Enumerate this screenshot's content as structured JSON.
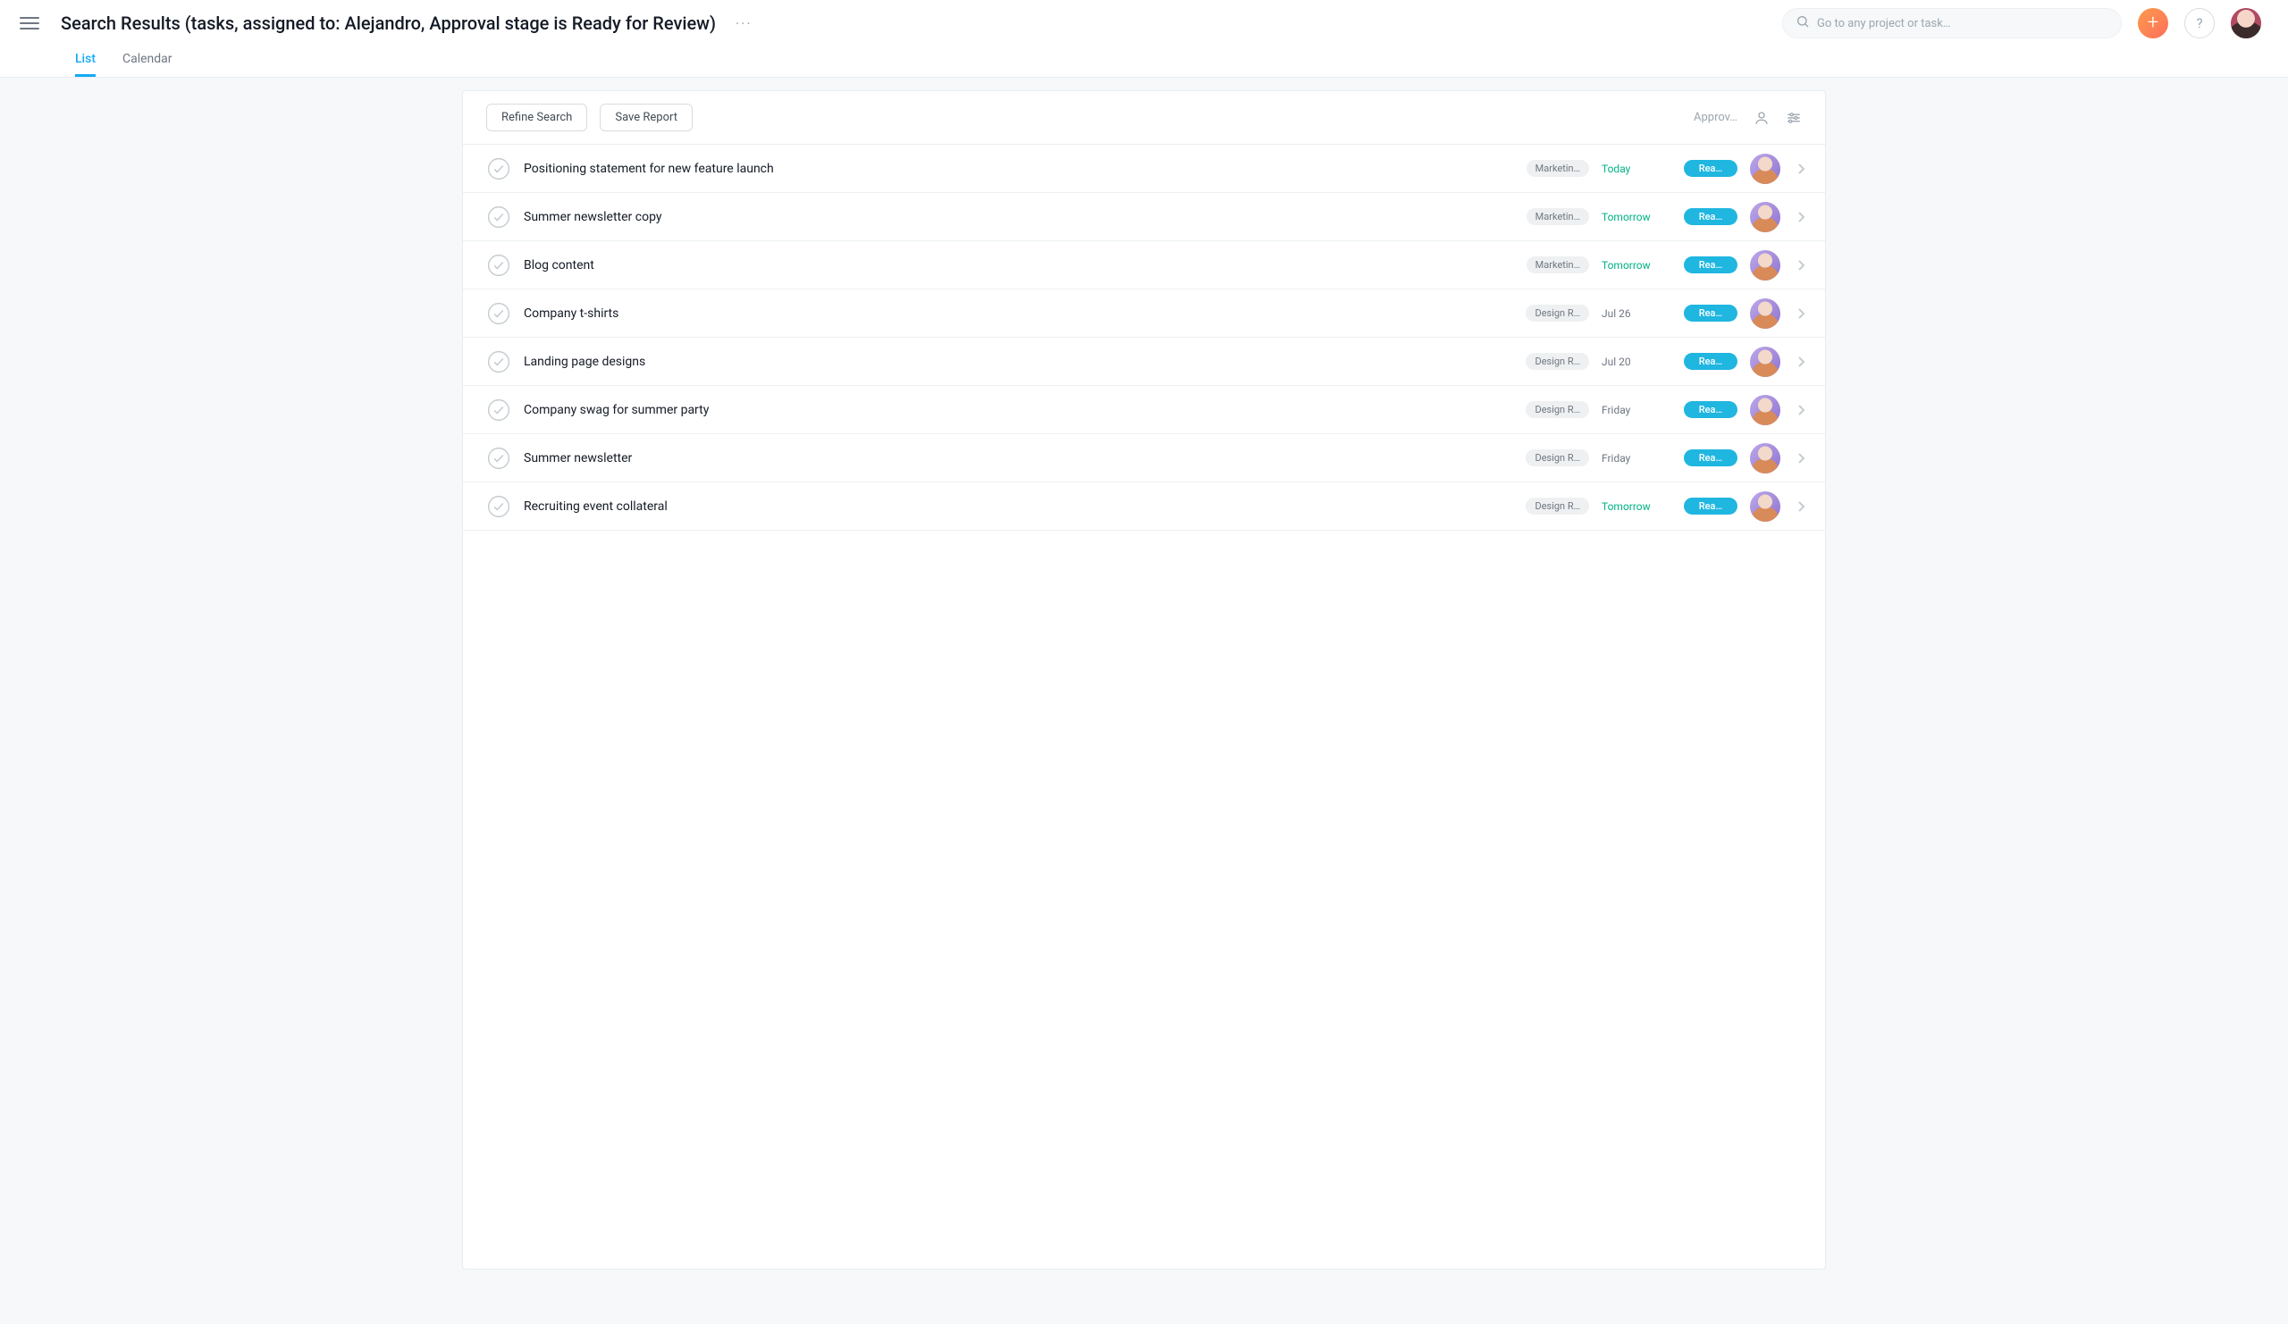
{
  "header": {
    "title": "Search Results (tasks, assigned to: Alejandro, Approval stage is Ready for Review)",
    "more_label": "···"
  },
  "search": {
    "placeholder": "Go to any project or task…"
  },
  "topbar_buttons": {
    "add_label": "+",
    "help_label": "?"
  },
  "tabs": [
    {
      "label": "List",
      "active": true
    },
    {
      "label": "Calendar",
      "active": false
    }
  ],
  "toolbar": {
    "refine_label": "Refine Search",
    "save_label": "Save Report",
    "filter_field_label": "Approv…"
  },
  "status_pill_label": "Rea…",
  "tasks": [
    {
      "name": "Positioning statement for new feature launch",
      "project": "Marketin…",
      "due": "Today",
      "due_color": "green"
    },
    {
      "name": "Summer newsletter copy",
      "project": "Marketin…",
      "due": "Tomorrow",
      "due_color": "green"
    },
    {
      "name": "Blog content",
      "project": "Marketin…",
      "due": "Tomorrow",
      "due_color": "green"
    },
    {
      "name": "Company t-shirts",
      "project": "Design R…",
      "due": "Jul 26",
      "due_color": "grey"
    },
    {
      "name": "Landing page designs",
      "project": "Design R…",
      "due": "Jul 20",
      "due_color": "grey"
    },
    {
      "name": "Company swag for summer party",
      "project": "Design R…",
      "due": "Friday",
      "due_color": "grey"
    },
    {
      "name": "Summer newsletter",
      "project": "Design R…",
      "due": "Friday",
      "due_color": "grey"
    },
    {
      "name": "Recruiting event collateral",
      "project": "Design R…",
      "due": "Tomorrow",
      "due_color": "green"
    }
  ]
}
